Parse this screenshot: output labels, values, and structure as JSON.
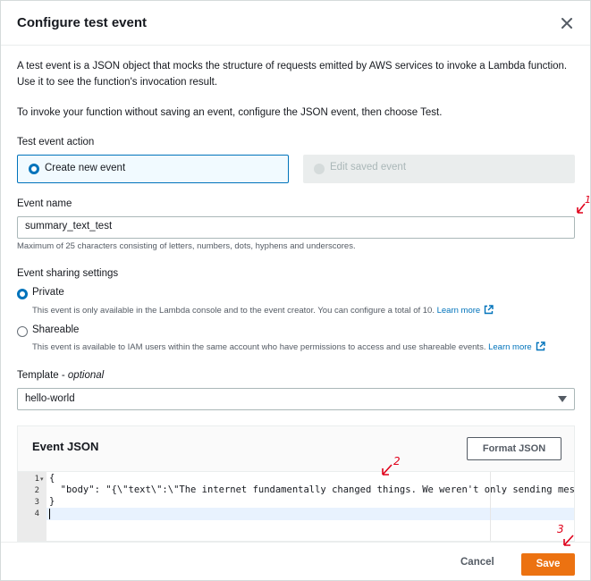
{
  "dialog": {
    "title": "Configure test event",
    "intro_line1": "A test event is a JSON object that mocks the structure of requests emitted by AWS services to invoke a Lambda function.",
    "intro_line2": "Use it to see the function's invocation result.",
    "intro_line3": "To invoke your function without saving an event, configure the JSON event, then choose Test."
  },
  "test_event_action": {
    "label": "Test event action",
    "create_new": "Create new event",
    "edit_saved": "Edit saved event"
  },
  "event_name": {
    "label": "Event name",
    "value": "summary_text_test",
    "hint": "Maximum of 25 characters consisting of letters, numbers, dots, hyphens and underscores."
  },
  "sharing": {
    "label": "Event sharing settings",
    "private_label": "Private",
    "private_desc": "This event is only available in the Lambda console and to the event creator. You can configure a total of 10.",
    "shareable_label": "Shareable",
    "shareable_desc": "This event is available to IAM users within the same account who have permissions to access and use shareable events.",
    "learn_more": "Learn more"
  },
  "template": {
    "label": "Template",
    "optional": "optional",
    "value": "hello-world"
  },
  "event_json": {
    "title": "Event JSON",
    "format_button": "Format JSON",
    "line_numbers": [
      "1",
      "2",
      "3",
      "4"
    ],
    "lines": [
      "{",
      "  \"body\": \"{\\\"text\\\":\\\"The internet fundamentally changed things. We weren't only sending messag",
      "}",
      ""
    ]
  },
  "footer": {
    "cancel": "Cancel",
    "save": "Save"
  },
  "annotations": [
    "1",
    "2",
    "3"
  ],
  "colors": {
    "accent": "#0073bb",
    "primary_button": "#ec7211",
    "annotation": "#e0001a"
  }
}
